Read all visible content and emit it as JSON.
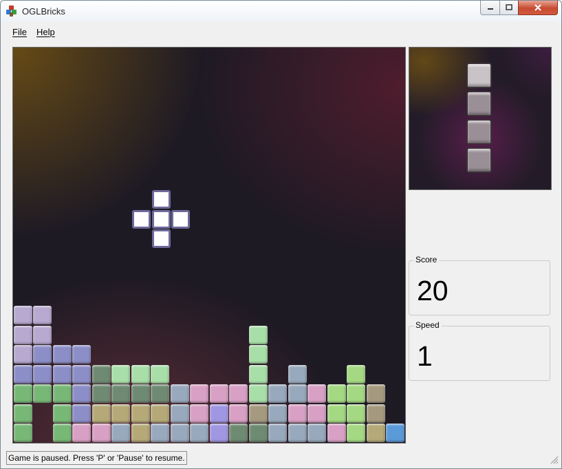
{
  "window": {
    "title": "OGLBricks"
  },
  "menu": {
    "file_label": "File",
    "help_label": "Help"
  },
  "score": {
    "label": "Score",
    "value": "20"
  },
  "speed": {
    "label": "Speed",
    "value": "1"
  },
  "status": {
    "text": "Game is paused. Press 'P' or 'Pause' to resume."
  },
  "colors": {
    "P": "#b7a9cf",
    "B": "#8c8ec8",
    "G": "#78b877",
    "M": "#6f8a72",
    "L": "#a8dea8",
    "S": "#98a9bd",
    "K": "#d8a0c4",
    "Y": "#b5a978",
    "A": "#a5d882",
    "T": "#a59a7f",
    "V": "#a097e3",
    "C": "#5b9ad8",
    "R": "#c2a0a8",
    "preview": "#9a8f96",
    "falling": "#ffffff"
  },
  "board": {
    "columns": 20,
    "rows": 20,
    "stack": [
      ".....................",
      "....................",
      "....................",
      "....................",
      "....................",
      "....................",
      "....................",
      "....................",
      "....................",
      "....................",
      "....................",
      "....................",
      "....................",
      "PP..................",
      "PP..........L.......",
      "PBBB........L.......",
      "BBBBMLLL....L.S..A..",
      "GGGBMMMMSKKKLSSKAAT.",
      "G.GBYYYYSKVKTSKKAAT.",
      "G.GKKSYSSSVMMSSSKAYC"
    ],
    "falling_piece": [
      [
        8,
        7
      ],
      [
        7,
        8
      ],
      [
        8,
        8
      ],
      [
        9,
        8
      ],
      [
        8,
        9
      ]
    ]
  },
  "next_piece": {
    "cells": [
      [
        0,
        0
      ],
      [
        0,
        1
      ],
      [
        0,
        2
      ],
      [
        0,
        3
      ]
    ]
  }
}
